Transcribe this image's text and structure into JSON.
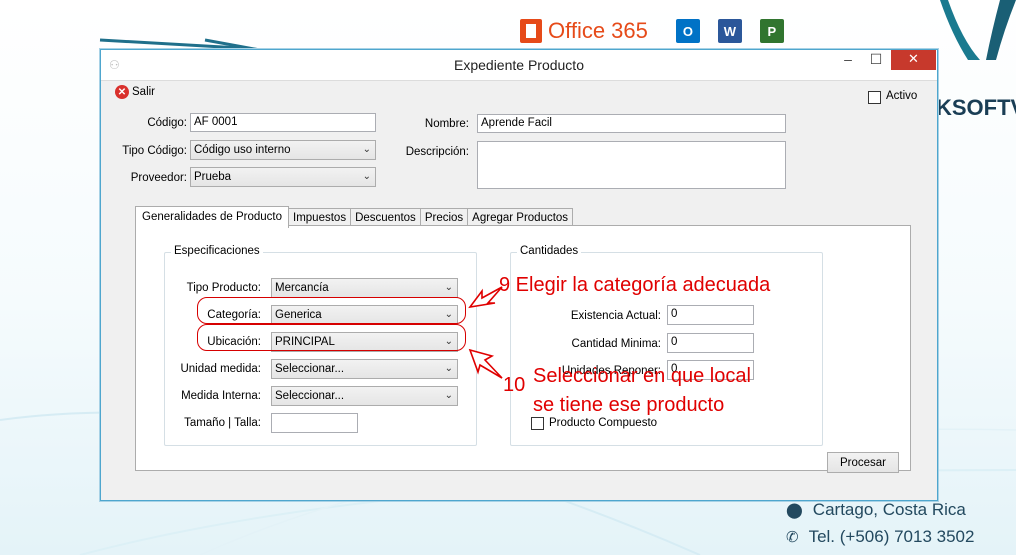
{
  "background": {
    "office_text": "Office 365",
    "app_tiles": [
      {
        "icon": "outlook-icon",
        "letter": "O",
        "color": "#0072c6"
      },
      {
        "icon": "word-icon",
        "letter": "W",
        "color": "#2b579a"
      },
      {
        "icon": "project-icon",
        "letter": "P",
        "color": "#31752f"
      }
    ],
    "brand_text": "KSOFTV",
    "contact_location": "Cartago, Costa Rica",
    "contact_phone": "Tel. (+506) 7013 3502"
  },
  "window": {
    "title": "Expediente Producto",
    "minimize_glyph": "–",
    "maximize_glyph": "☐",
    "close_glyph": "✕"
  },
  "toolbar": {
    "salir_label": "Salir"
  },
  "activo": {
    "label": "Activo"
  },
  "header_form": {
    "codigo_label": "Código:",
    "codigo_value": "AF 0001",
    "tipo_codigo_label": "Tipo Código:",
    "tipo_codigo_value": "Código uso interno",
    "proveedor_label": "Proveedor:",
    "proveedor_value": "Prueba",
    "nombre_label": "Nombre:",
    "nombre_value": "Aprende Facil",
    "descripcion_label": "Descripción:",
    "descripcion_value": ""
  },
  "tabs": [
    {
      "label": "Generalidades de Producto",
      "active": true
    },
    {
      "label": "Impuestos"
    },
    {
      "label": "Descuentos"
    },
    {
      "label": "Precios"
    },
    {
      "label": "Agregar Productos"
    }
  ],
  "especificaciones": {
    "title": "Especificaciones",
    "tipo_producto_label": "Tipo Producto:",
    "tipo_producto_value": "Mercancía",
    "categoria_label": "Categoría:",
    "categoria_value": "Generica",
    "ubicacion_label": "Ubicación:",
    "ubicacion_value": "PRINCIPAL",
    "unidad_medida_label": "Unidad medida:",
    "unidad_medida_value": "Seleccionar...",
    "medida_interna_label": "Medida Interna:",
    "medida_interna_value": "Seleccionar...",
    "tamano_label": "Tamaño | Talla:",
    "tamano_value": ""
  },
  "cantidades": {
    "title": "Cantidades",
    "existencia_label": "Existencia Actual:",
    "existencia_value": "0",
    "cantidad_minima_label": "Cantidad Minima:",
    "cantidad_minima_value": "0",
    "unidades_reponer_label": "Unidades Reponer:",
    "unidades_reponer_value": "0",
    "producto_compuesto_label": "Producto Compuesto"
  },
  "procesar_label": "Procesar",
  "annotations": {
    "step9": "9 Elegir la categoría adecuada",
    "step10_number": "10",
    "step10_line1": "Seleccionar en que local",
    "step10_line2": "se tiene ese producto",
    "color": "#e00000"
  }
}
